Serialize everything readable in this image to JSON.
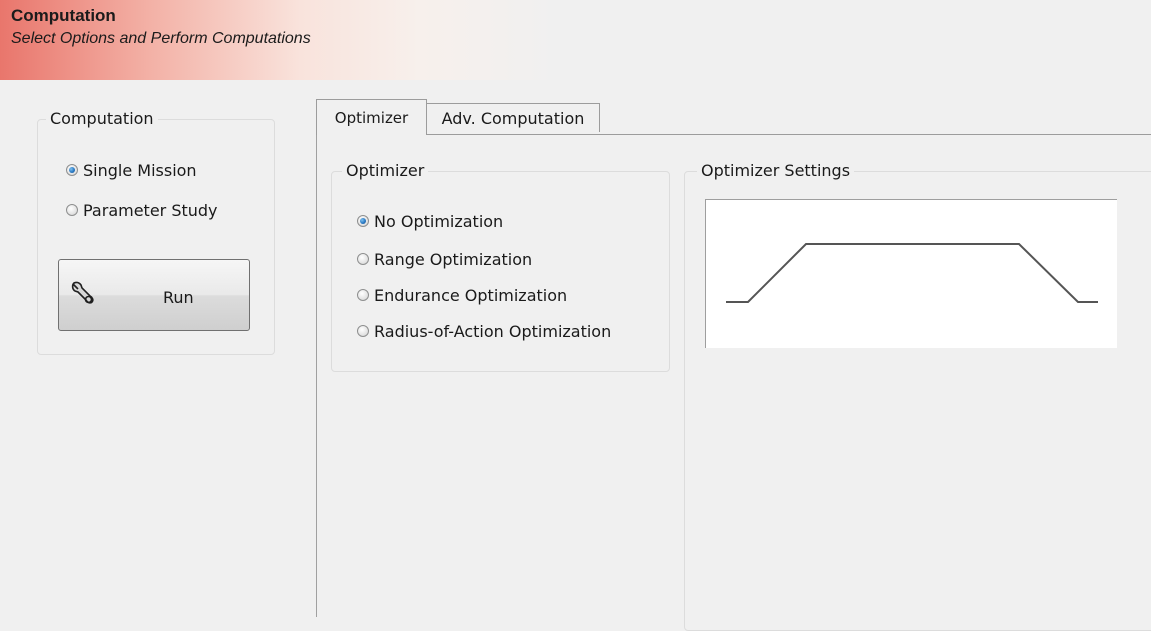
{
  "header": {
    "title": "Computation",
    "subtitle": "Select Options and Perform Computations"
  },
  "computation_group": {
    "legend": "Computation",
    "options": [
      {
        "label": "Single Mission",
        "checked": true
      },
      {
        "label": "Parameter Study",
        "checked": false
      }
    ],
    "run_button": {
      "label": "Run",
      "icon": "wrench-icon"
    }
  },
  "tabs": [
    {
      "label": "Optimizer",
      "active": true
    },
    {
      "label": "Adv. Computation",
      "active": false
    }
  ],
  "optimizer_group": {
    "legend": "Optimizer",
    "options": [
      {
        "label": "No Optimization",
        "checked": true
      },
      {
        "label": "Range Optimization",
        "checked": false
      },
      {
        "label": "Endurance Optimization",
        "checked": false
      },
      {
        "label": "Radius-of-Action Optimization",
        "checked": false
      }
    ]
  },
  "optimizer_settings_group": {
    "legend": "Optimizer Settings",
    "preview_icon": "mission-profile-icon"
  }
}
